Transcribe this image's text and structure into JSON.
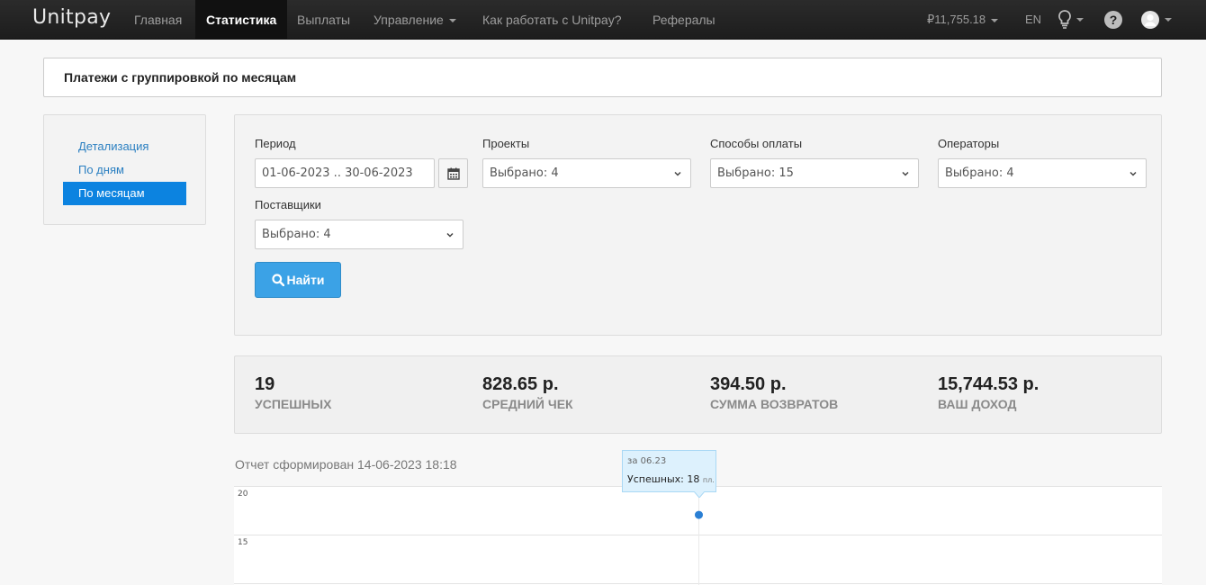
{
  "nav": {
    "brand": "Unitpay",
    "items": [
      {
        "label": "Главная"
      },
      {
        "label": "Статистика"
      },
      {
        "label": "Выплаты"
      },
      {
        "label": "Управление"
      },
      {
        "label": "Как работать с Unitpay?"
      },
      {
        "label": "Рефералы"
      }
    ],
    "balance": "₽11,755.18",
    "lang": "EN"
  },
  "header": {
    "title": "Платежи с группировкой по месяцам"
  },
  "sidebar": {
    "items": [
      {
        "label": "Детализация"
      },
      {
        "label": "По дням"
      },
      {
        "label": "По месяцам"
      }
    ]
  },
  "filters": {
    "period": {
      "label": "Период",
      "value": "01-06-2023 .. 30-06-2023"
    },
    "projects": {
      "label": "Проекты",
      "value": "Выбрано: 4"
    },
    "payment_methods": {
      "label": "Способы оплаты",
      "value": "Выбрано: 15"
    },
    "operators": {
      "label": "Операторы",
      "value": "Выбрано: 4"
    },
    "suppliers": {
      "label": "Поставщики",
      "value": "Выбрано: 4"
    },
    "find_label": "Найти"
  },
  "stats": [
    {
      "value": "19",
      "caption": "УСПЕШНЫХ"
    },
    {
      "value": "828.65 р.",
      "caption": "СРЕДНИЙ ЧЕК"
    },
    {
      "value": "394.50 р.",
      "caption": "СУММА ВОЗВРАТОВ"
    },
    {
      "value": "15,744.53 р.",
      "caption": "ВАШ ДОХОД"
    }
  ],
  "report": {
    "generated": "Отчет сформирован 14-06-2023 18:18"
  },
  "chart_data": {
    "type": "line",
    "x": [
      "06.23"
    ],
    "series": [
      {
        "name": "Успешных",
        "values": [
          18
        ]
      }
    ],
    "yticks": [
      "20",
      "15"
    ],
    "tooltip": {
      "title": "за 06.23",
      "label": "Успешных:",
      "value": "18",
      "unit": "пл."
    }
  },
  "colors": {
    "accent": "#0c83e0",
    "button": "#3ba2e6",
    "point": "#2a7fd4"
  }
}
